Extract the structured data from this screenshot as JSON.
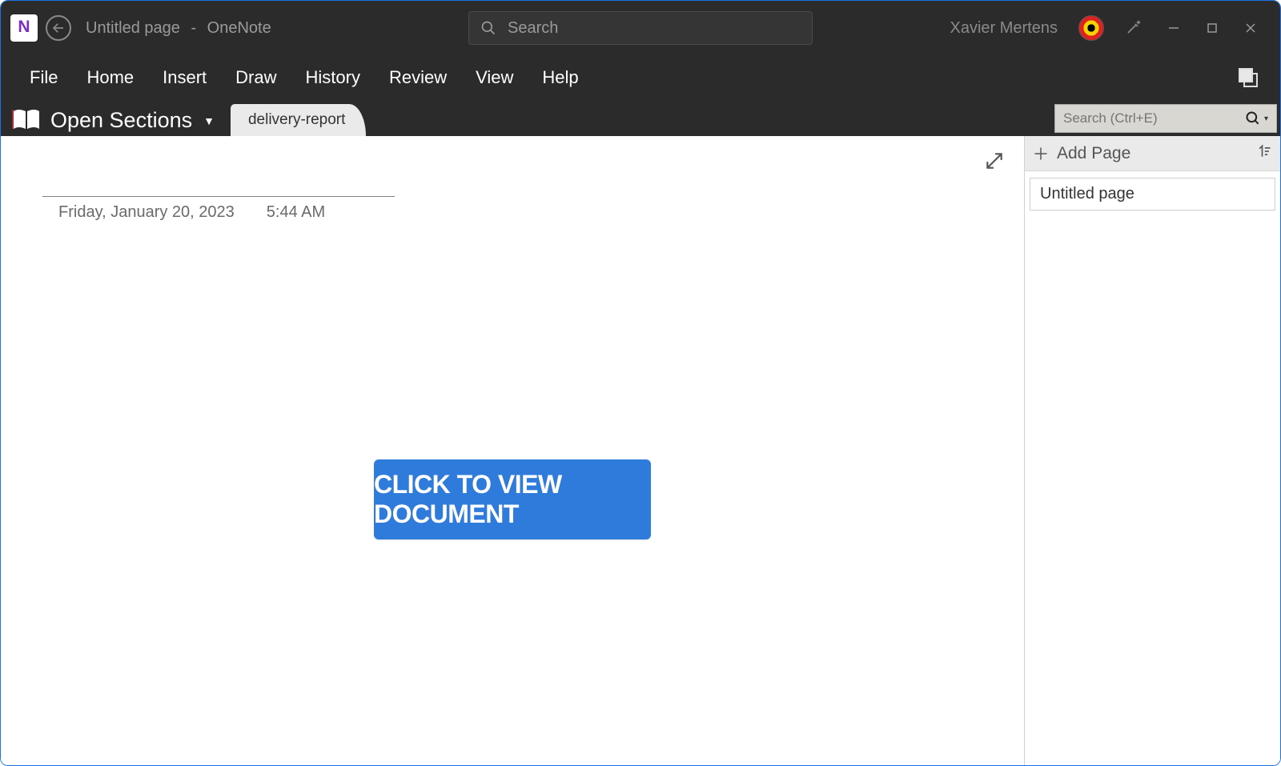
{
  "titlebar": {
    "app_letter": "N",
    "doc_title": "Untitled page",
    "app_name": "OneNote",
    "search_placeholder": "Search",
    "username": "Xavier Mertens"
  },
  "menubar": {
    "items": [
      "File",
      "Home",
      "Insert",
      "Draw",
      "History",
      "Review",
      "View",
      "Help"
    ]
  },
  "notebookbar": {
    "open_sections_label": "Open Sections",
    "section_tab": "delivery-report",
    "page_search_placeholder": "Search (Ctrl+E)"
  },
  "canvas": {
    "date": "Friday, January 20, 2023",
    "time": "5:44 AM",
    "big_button_label": "CLICK TO VIEW DOCUMENT"
  },
  "page_panel": {
    "add_page_label": "Add Page",
    "pages": [
      "Untitled page"
    ]
  }
}
